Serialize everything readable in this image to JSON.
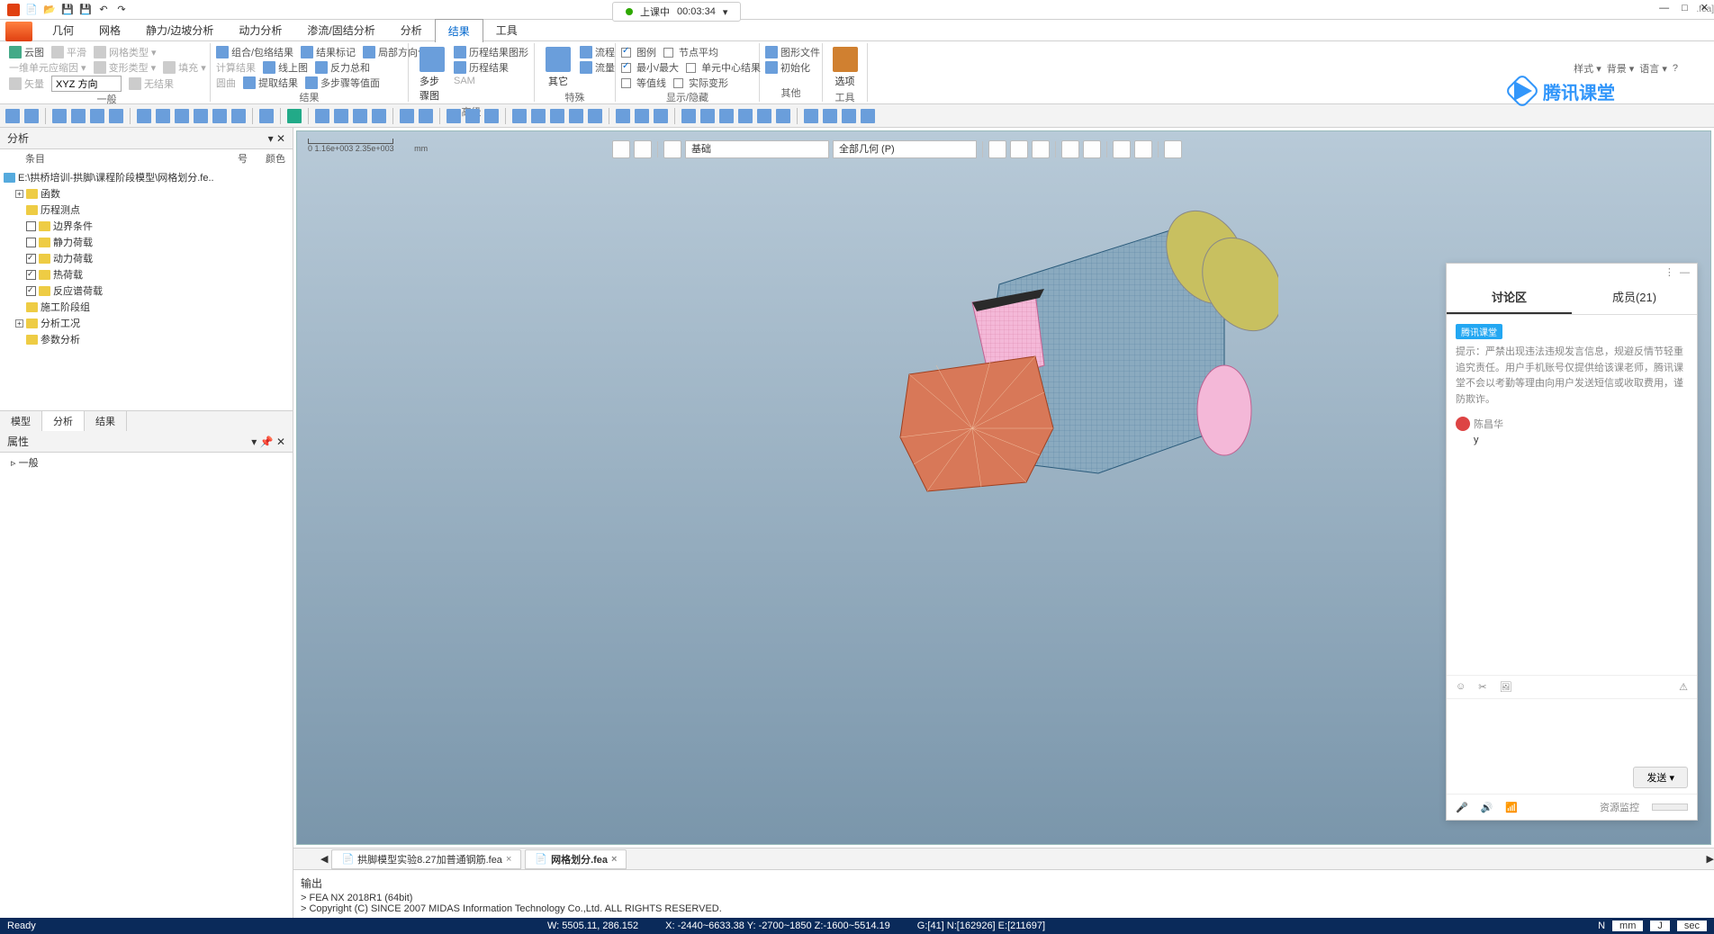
{
  "titlebar_file": ".fea]",
  "recording": {
    "label": "上课中",
    "time": "00:03:34"
  },
  "top_right": {
    "style": "样式 ▾",
    "bg": "背景 ▾",
    "lang": "语言 ▾"
  },
  "menu": {
    "items": [
      "几何",
      "网格",
      "静力/边坡分析",
      "动力分析",
      "渗流/固结分析",
      "分析",
      "结果",
      "工具"
    ],
    "active_index": 6
  },
  "ribbon": {
    "g1": {
      "label": "一般",
      "r1": [
        "云图",
        "平滑",
        "网格类型 ▾"
      ],
      "r2": [
        "一维单元应缩因 ▾",
        "变形类型 ▾",
        "填充 ▾"
      ],
      "r3": [
        "矢量",
        "XYZ 方向",
        "无结果"
      ],
      "dd": "XYZ 方向"
    },
    "g2": {
      "label": "结果",
      "r1": [
        "组合/包络结果",
        "结果标记",
        "局部方向合力"
      ],
      "r2": [
        "计算结果",
        "线上图",
        "反力总和"
      ],
      "r3": [
        "圆曲",
        "提取结果",
        "多步骤等值面"
      ]
    },
    "g3": {
      "label": "高级",
      "big": "多步骤图",
      "r1": [
        "历程结果图形"
      ],
      "r2": [
        "历程结果"
      ],
      "r3": [
        "SAM"
      ]
    },
    "g4": {
      "label": "特殊",
      "big": "其它",
      "r1": [
        "流程"
      ],
      "r2": [
        "流量"
      ]
    },
    "g5": {
      "label": "显示/隐藏",
      "r1": [
        {
          "c": true,
          "t": "图例"
        },
        {
          "c": false,
          "t": "节点平均"
        }
      ],
      "r2": [
        {
          "c": true,
          "t": "最小/最大"
        },
        {
          "c": false,
          "t": "单元中心结果"
        }
      ],
      "r3": [
        {
          "c": false,
          "t": "等值线"
        },
        {
          "c": false,
          "t": "实际变形"
        }
      ]
    },
    "g6": {
      "label": "其他",
      "r1": [
        "图形文件"
      ],
      "r2": [
        "初始化"
      ]
    },
    "g7": {
      "label": "工具",
      "big": "选项"
    }
  },
  "left": {
    "title": "分析",
    "cols": [
      "条目",
      "号",
      "颜色"
    ],
    "root": "E:\\拱桥培训-拱脚\\课程阶段模型\\网格划分.fe..",
    "nodes": [
      {
        "t": "函数",
        "exp": true
      },
      {
        "t": "历程测点"
      },
      {
        "t": "边界条件",
        "chk": false,
        "hasChk": true
      },
      {
        "t": "静力荷载",
        "chk": false,
        "hasChk": true
      },
      {
        "t": "动力荷载",
        "chk": true,
        "hasChk": true
      },
      {
        "t": "热荷载",
        "chk": true,
        "hasChk": true
      },
      {
        "t": "反应谱荷载",
        "chk": true,
        "hasChk": true
      },
      {
        "t": "施工阶段组"
      },
      {
        "t": "分析工况",
        "exp": true
      },
      {
        "t": "参数分析"
      }
    ],
    "tabs": [
      "模型",
      "分析",
      "结果"
    ],
    "tabs_active": 1,
    "props_title": "属性",
    "props_row": "一般"
  },
  "viewport": {
    "scale": "0    1.16e+003 2.35e+003",
    "unit": "mm",
    "sel1": "基础",
    "sel2": "全部几何 (P)"
  },
  "file_tabs": [
    {
      "name": "拱脚模型实验8.27加普通钢筋.fea",
      "active": false
    },
    {
      "name": "网格划分.fea",
      "active": true
    }
  ],
  "output": {
    "title": "输出",
    "lines": [
      "> FEA NX 2018R1 (64bit)",
      "> Copyright (C) SINCE 2007 MIDAS Information Technology Co.,Ltd. ALL RIGHTS RESERVED."
    ]
  },
  "status": {
    "ready": "Ready",
    "w": "W: 5505.11, 286.152",
    "xyz": "X: -2440~6633.38 Y: -2700~1850 Z:-1600~5514.19",
    "g": "G:[41] N:[162926] E:[211697]",
    "n": "N",
    "unit1": "mm",
    "unit2": "J",
    "unit3": "sec"
  },
  "tencent": "腾讯课堂",
  "chat": {
    "tabs": [
      "讨论区",
      "成员(21)"
    ],
    "active": 0,
    "badge": "腾讯课堂",
    "notice": "提示：严禁出现违法违规发言信息，规避反情节轻重追究责任。用户手机账号仅提供给该课老师，腾讯课堂不会以考勤等理由向用户发送短信或收取费用，谨防欺诈。",
    "user": "陈昌华",
    "msg": "y",
    "send": "发送 ▾",
    "monitor": "资源监控"
  }
}
